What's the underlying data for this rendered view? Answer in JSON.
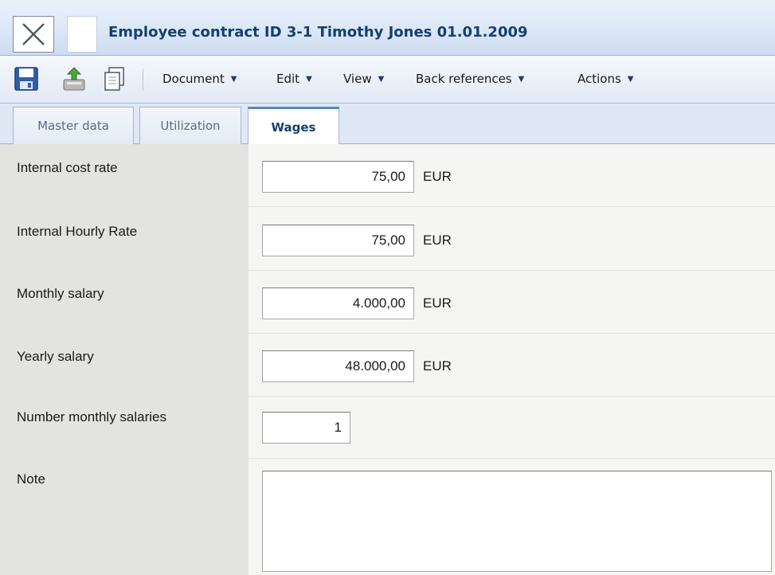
{
  "window": {
    "title": "Employee contract ID 3-1 Timothy Jones 01.01.2009"
  },
  "toolbar": {
    "icons": [
      "save-icon",
      "export-icon",
      "copy-icon"
    ],
    "menus": [
      {
        "label": "Document",
        "arrow": "▼"
      },
      {
        "label": "Edit",
        "arrow": "▼"
      },
      {
        "label": "View",
        "arrow": "▼"
      },
      {
        "label": "Back references",
        "arrow": "▼"
      },
      {
        "label": "Actions",
        "arrow": "▼"
      }
    ]
  },
  "tabs": [
    {
      "label": "Master data",
      "active": false
    },
    {
      "label": "Utilization",
      "active": false
    },
    {
      "label": "Wages",
      "active": true
    }
  ],
  "form": {
    "fields": [
      {
        "label": "Internal cost rate",
        "value": "75,00",
        "unit": "EUR"
      },
      {
        "label": "Internal Hourly Rate",
        "value": "75,00",
        "unit": "EUR"
      },
      {
        "label": "Monthly salary",
        "value": "4.000,00",
        "unit": "EUR"
      },
      {
        "label": "Yearly salary",
        "value": "48.000,00",
        "unit": "EUR"
      },
      {
        "label": "Number monthly salaries",
        "value": "1",
        "unit": ""
      }
    ],
    "note": {
      "label": "Note",
      "value": ""
    }
  },
  "colors": {
    "title_text": "#14406e",
    "label_column": "#e3e3e0",
    "value_column": "#f5f5f3",
    "active_tab_accent": "#5b86c3"
  }
}
